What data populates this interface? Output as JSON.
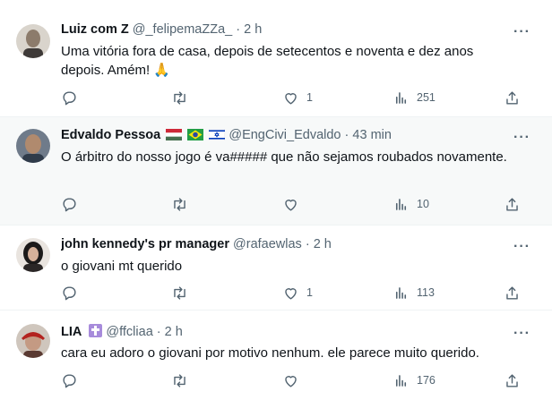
{
  "tweets": [
    {
      "name": "Luiz com Z",
      "handle": "@_felipemaZZa_",
      "dot": "·",
      "time": "2 h",
      "text": "Uma vitória fora de casa, depois de setecentos e noventa e dez anos depois. Amém! 🙏",
      "replies": "",
      "retweets": "",
      "likes": "1",
      "views": "251"
    },
    {
      "name": "Edvaldo Pessoa",
      "handle": "@EngCivi_Edvaldo",
      "dot": "·",
      "time": "43 min",
      "text": "O árbitro do nosso jogo é va##### que não sejamos roubados novamente.",
      "replies": "",
      "retweets": "",
      "likes": "",
      "views": "10"
    },
    {
      "name": "john kennedy's pr manager",
      "handle": "@rafaewlas",
      "dot": "·",
      "time": "2 h",
      "text": "o giovani mt querido",
      "replies": "",
      "retweets": "",
      "likes": "1",
      "views": "113"
    },
    {
      "name": "LIA",
      "handle": "@ffcliaa",
      "dot": "·",
      "time": "2 h",
      "text": "cara eu adoro o giovani por motivo nenhum. ele parece muito querido.",
      "replies": "",
      "retweets": "",
      "likes": "",
      "views": "176"
    }
  ],
  "icons": {
    "more": "more-horizontal-icon",
    "reply": "reply-icon",
    "retweet": "retweet-icon",
    "like": "heart-icon",
    "views": "views-icon",
    "share": "share-icon"
  },
  "colors": {
    "text": "#0f1419",
    "secondary": "#536471",
    "highlight_bg": "#f7f9f9",
    "border": "#eff3f4"
  }
}
